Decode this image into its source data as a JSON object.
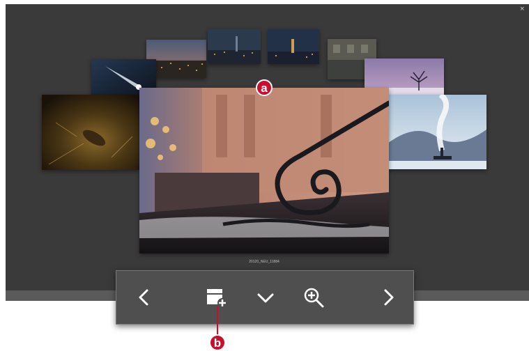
{
  "viewer": {
    "close_glyph": "×",
    "current_filename": "20120_NEU_11884"
  },
  "photos": [
    {
      "id": "city-night-1",
      "subject": "city lights at dusk"
    },
    {
      "id": "city-night-2",
      "subject": "city skyline at night"
    },
    {
      "id": "city-night-3",
      "subject": "illuminated tower at night"
    },
    {
      "id": "building-facade",
      "subject": "old facade"
    },
    {
      "id": "light-trail",
      "subject": "light beam in dark sky"
    },
    {
      "id": "winter-tree",
      "subject": "bare tree in snow at dusk"
    },
    {
      "id": "pine-cone",
      "subject": "pine cone on forest floor"
    },
    {
      "id": "iron-railing",
      "subject": "curled iron railing with snow"
    },
    {
      "id": "steam-ship",
      "subject": "steam over frozen landscape"
    }
  ],
  "toolbar": {
    "icons": [
      "chevron-left-icon",
      "add-to-collection-icon",
      "chevron-down-icon",
      "zoom-in-icon",
      "chevron-right-icon"
    ]
  },
  "callouts": {
    "a": "a",
    "b": "b",
    "color": "#c8102e"
  }
}
